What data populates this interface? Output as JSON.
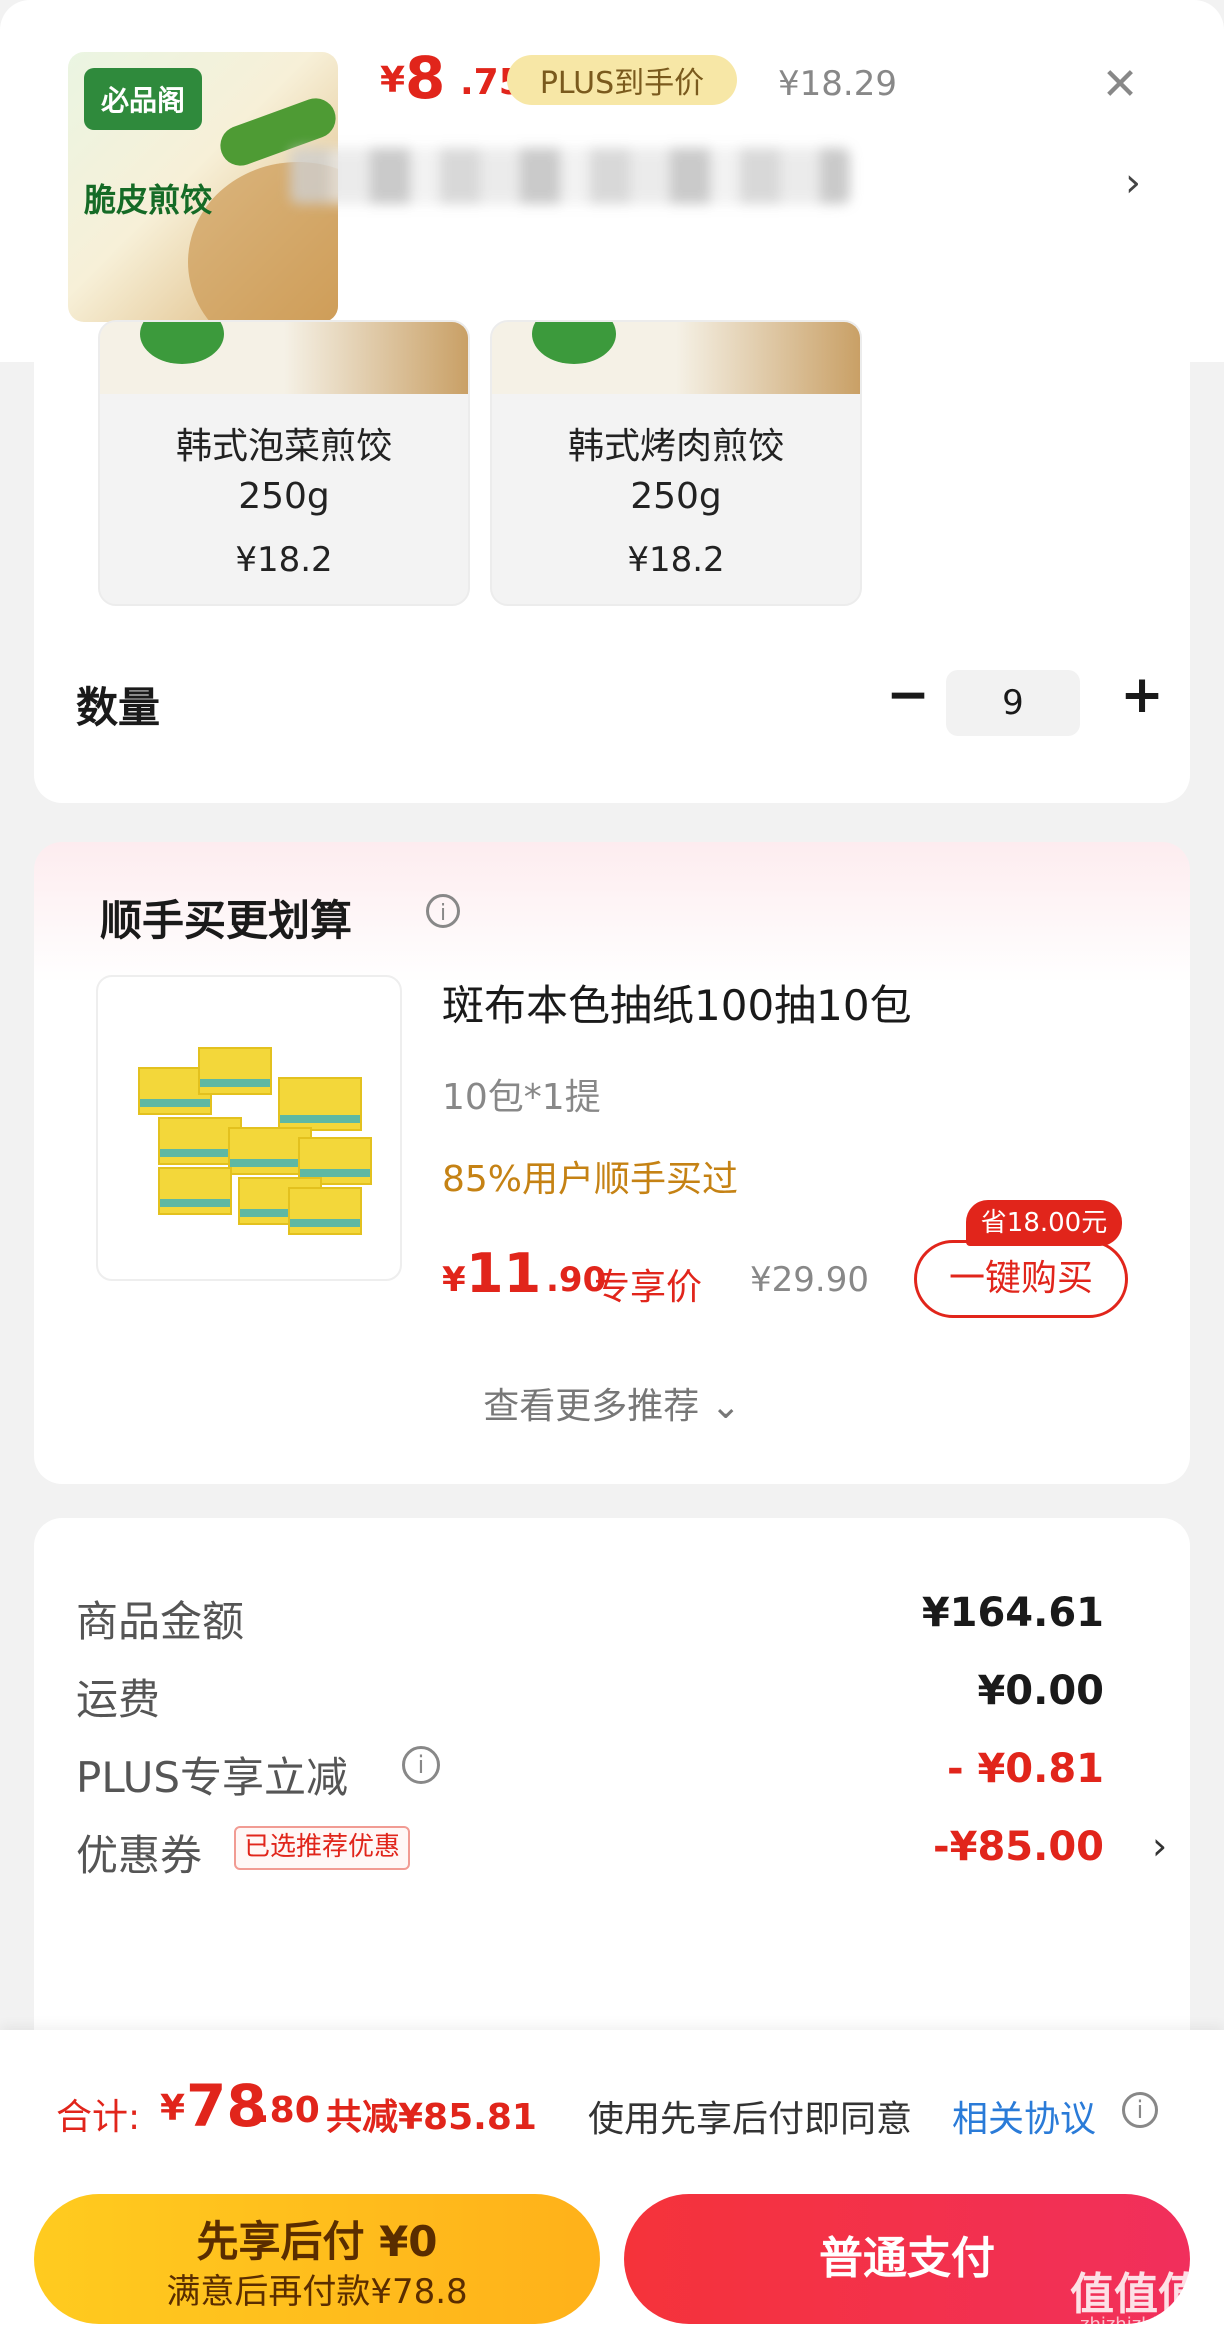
{
  "header": {
    "thumb": {
      "brand": "必品阁",
      "name": "脆皮煎饺"
    },
    "price_symbol": "¥",
    "price_int": "8",
    "price_dec": ".75",
    "plus_badge": "PLUS到手价",
    "original_price": "¥18.29",
    "close_icon": "close-icon",
    "spec_chevron": "›"
  },
  "variants": [
    {
      "name_line1": "韩式泡菜煎饺",
      "name_line2": "250g",
      "price": "¥18.2"
    },
    {
      "name_line1": "韩式烤肉煎饺",
      "name_line2": "250g",
      "price": "¥18.2"
    }
  ],
  "quantity": {
    "label": "数量",
    "minus": "−",
    "value": "9",
    "plus": "+"
  },
  "recommend": {
    "title": "顺手买更划算",
    "info_icon": "i",
    "product_name": "斑布本色抽纸100抽10包",
    "spec": "10包*1提",
    "social": "85%用户顺手买过",
    "price_symbol": "¥",
    "price_int": "11",
    "price_dec": ".90",
    "exclusive_label": "专享价",
    "original_price": "¥29.90",
    "save_badge": "省18.00元",
    "buy_button": "一键购买",
    "more": "查看更多推荐 ⌄"
  },
  "summary": {
    "rows": [
      {
        "label": "商品金额",
        "value": "¥164.61"
      },
      {
        "label": "运费",
        "value": "¥0.00"
      },
      {
        "label": "PLUS专享立减",
        "value": "- ¥0.81"
      },
      {
        "label": "优惠券",
        "value": "-¥85.00"
      }
    ],
    "coupon_tag": "已选推荐优惠",
    "chevron": "›",
    "info_icon": "i"
  },
  "bottom": {
    "total_label": "合计:",
    "total_symbol": "¥",
    "total_int": "78",
    "total_dec": ".80",
    "total_save": "共减¥85.81",
    "agree_text": "使用先享后付即同意",
    "agree_link": "相关协议",
    "info_icon": "i",
    "pay_later_line1": "先享后付 ¥0",
    "pay_later_line2": "满意后再付款¥78.8",
    "pay_normal": "普通支付"
  },
  "watermark": {
    "main": "值值值",
    "sub": "zhizhizhi.com"
  },
  "colors": {
    "accent_red": "#e1251b",
    "plus_gold": "#f7e7a6",
    "link_blue": "#2a7bd8",
    "pay_yellow": "#ffb11a"
  }
}
